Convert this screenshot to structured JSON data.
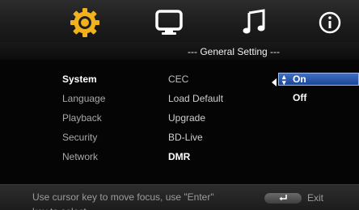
{
  "tabs": [
    {
      "name": "setup",
      "icon": "gear-icon",
      "active": true
    },
    {
      "name": "display",
      "icon": "monitor-icon",
      "active": false
    },
    {
      "name": "audio",
      "icon": "music-note-icon",
      "active": false
    },
    {
      "name": "info",
      "icon": "info-icon",
      "active": false
    }
  ],
  "header": {
    "title": "--- General Setting ---"
  },
  "menu": {
    "items": [
      {
        "label": "System",
        "active": true
      },
      {
        "label": "Language",
        "active": false
      },
      {
        "label": "Playback",
        "active": false
      },
      {
        "label": "Security",
        "active": false
      },
      {
        "label": "Network",
        "active": false
      }
    ]
  },
  "options": {
    "items": [
      {
        "label": "CEC"
      },
      {
        "label": "Load Default"
      },
      {
        "label": "Upgrade"
      },
      {
        "label": "BD-Live"
      },
      {
        "label": "DMR"
      }
    ]
  },
  "values": {
    "selected": "On",
    "other": "Off"
  },
  "help": {
    "text": "Use cursor key to move focus, use \"Enter\" key to select.",
    "exit_label": "Exit"
  },
  "colors": {
    "accent_gold": "#f2b21c",
    "highlight_blue": "#2f5fb8",
    "background": "#050505"
  }
}
